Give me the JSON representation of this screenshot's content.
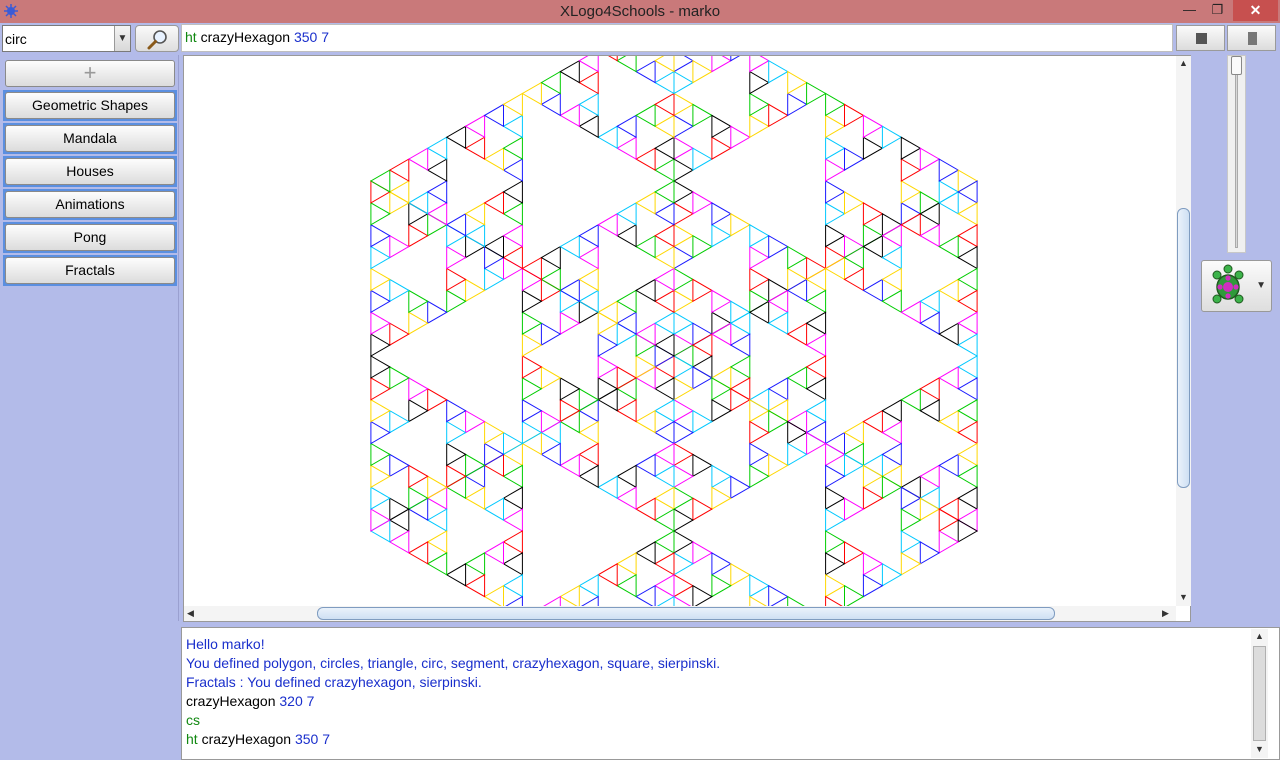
{
  "window": {
    "title": "XLogo4Schools - marko",
    "controls": {
      "minimize": "—",
      "maximize": "❐",
      "close": "✕"
    }
  },
  "toolbar": {
    "search_value": "circ",
    "command_keyword": "ht",
    "command_name": "crazyHexagon",
    "command_args": "350 7"
  },
  "sidebar": {
    "add_label": "+",
    "items": [
      {
        "label": "Geometric Shapes"
      },
      {
        "label": "Mandala"
      },
      {
        "label": "Houses"
      },
      {
        "label": "Animations"
      },
      {
        "label": "Pong"
      },
      {
        "label": "Fractals"
      }
    ]
  },
  "console": {
    "lines": [
      {
        "text": "Hello marko!",
        "color": "#1a2fcc"
      },
      {
        "text": "You defined polygon, circles, triangle, circ, segment, crazyhexagon, square, sierpinski.",
        "color": "#1a2fcc"
      },
      {
        "text": "Fractals : You defined crazyhexagon, sierpinski.",
        "color": "#1a2fcc"
      },
      {
        "keyword": "",
        "name": "crazyHexagon",
        "args": "320 7"
      },
      {
        "keyword": "cs",
        "name": "",
        "args": ""
      },
      {
        "keyword": "ht",
        "name": "crazyHexagon",
        "args": "350 7"
      }
    ]
  },
  "canvas": {
    "drawing": "sierpinski-hexagon-fractal",
    "edge_colors": [
      "#ff00ff",
      "#00c8ff",
      "#1a1aff",
      "#ffd700",
      "#00cc00",
      "#ff0000",
      "#000000"
    ]
  },
  "colors": {
    "title_bar": "#c9797a",
    "close_button": "#c7504f",
    "sidebar_bg": "#b3bbe9",
    "sidebar_highlight": "#5b8fe0",
    "keyword_green": "#118811",
    "text_blue": "#1a2fcc"
  }
}
